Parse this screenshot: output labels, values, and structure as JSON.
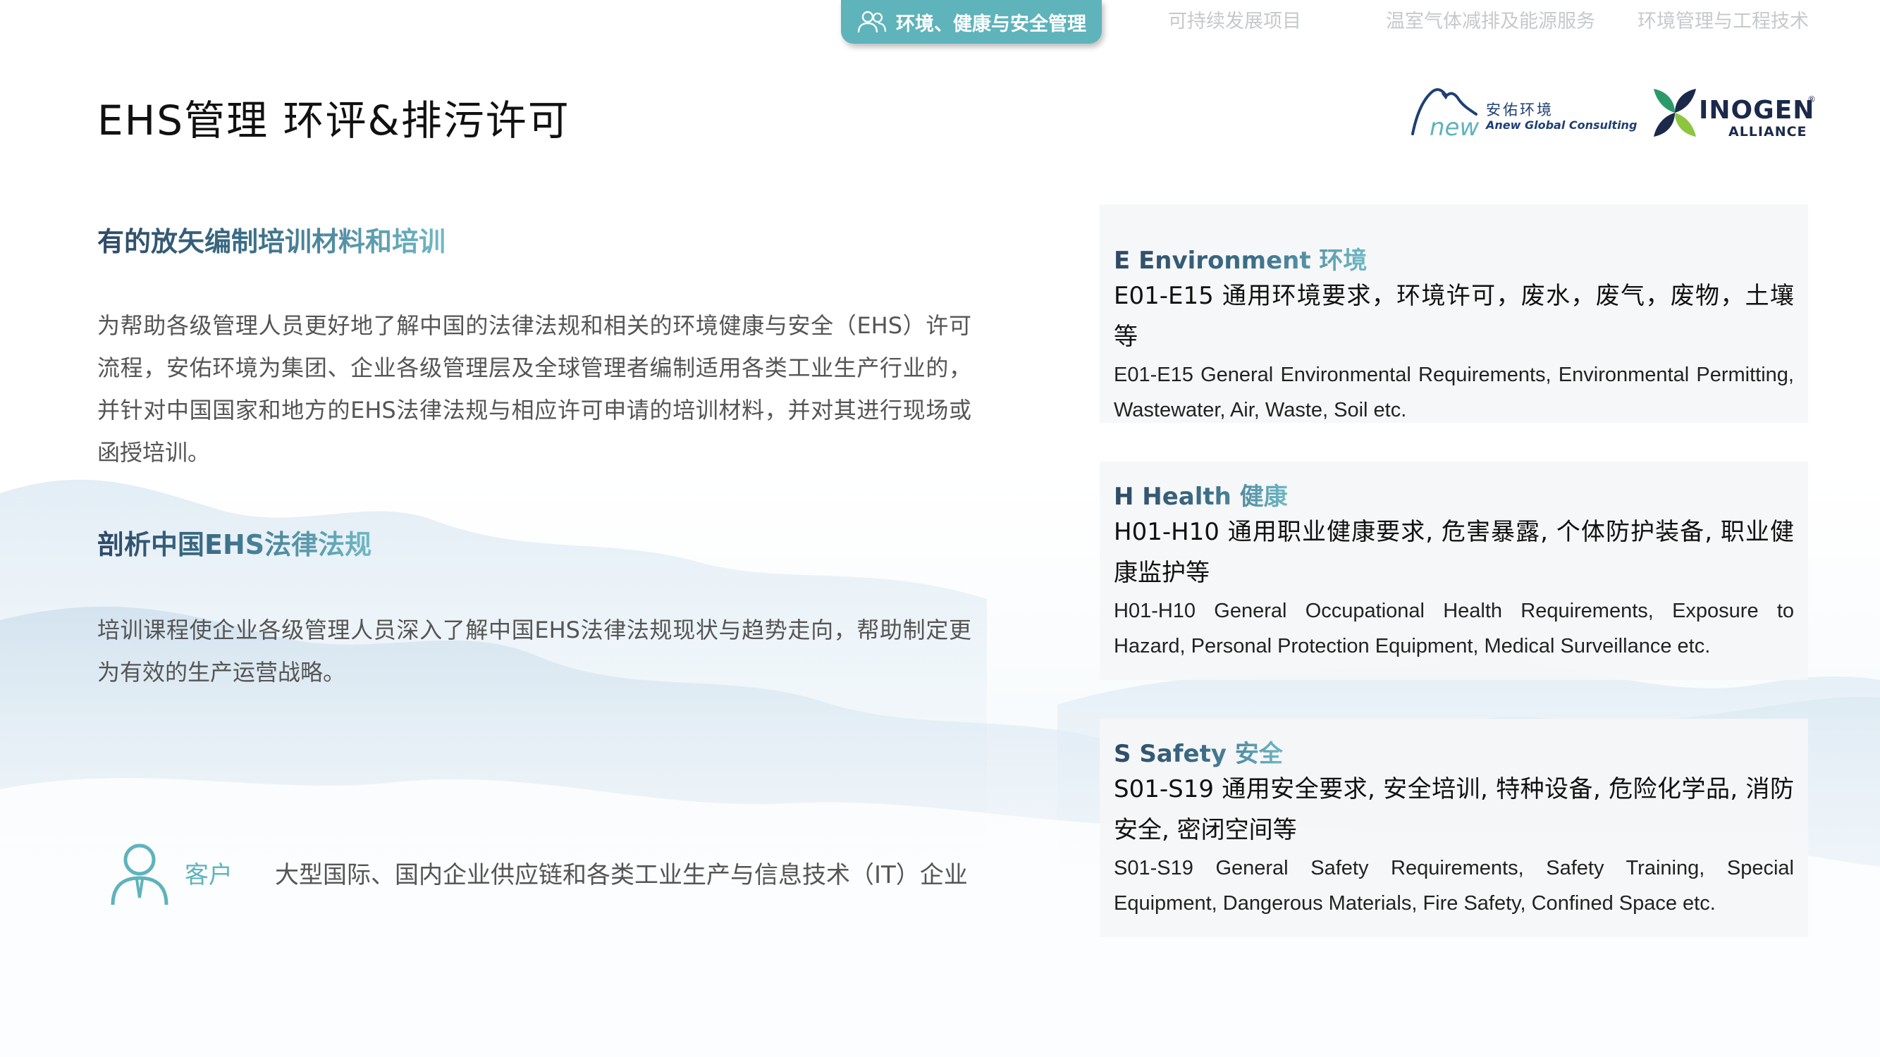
{
  "nav": {
    "active": "环境、健康与安全管理",
    "items": [
      "可持续发展项目",
      "温室气体减排及能源服务",
      "环境管理与工程技术"
    ]
  },
  "title": "EHS管理  环评&排污许可",
  "logos": {
    "anew_cn": "安佑环境",
    "anew_en": "Anew Global Consulting",
    "anew_mark": "new",
    "inogen_name": "INOGEN",
    "inogen_sub": "ALLIANCE",
    "inogen_reg": "®"
  },
  "sections": [
    {
      "heading": "有的放矢编制培训材料和培训",
      "body": "为帮助各级管理人员更好地了解中国的法律法规和相关的环境健康与安全（EHS）许可流程，安佑环境为集团、企业各级管理层及全球管理者编制适用各类工业生产行业的，并针对中国国家和地方的EHS法律法规与相应许可申请的培训材料，并对其进行现场或函授培训。"
    },
    {
      "heading": "剖析中国EHS法律法规",
      "body": "培训课程使企业各级管理人员深入了解中国EHS法律法规现状与趋势走向，帮助制定更为有效的生产运营战略。"
    }
  ],
  "client": {
    "label": "客户",
    "text": "大型国际、国内企业供应链和各类工业生产与信息技术（IT）企业"
  },
  "cards": [
    {
      "title": "E Environment 环境",
      "cn": "E01-E15 通用环境要求，环境许可，废水，废气，废物，土壤等",
      "en": "E01-E15 General Environmental Requirements, Environmental Permitting, Wastewater, Air, Waste, Soil etc."
    },
    {
      "title": "H Health 健康",
      "cn": "H01-H10 通用职业健康要求, 危害暴露, 个体防护装备, 职业健康监护等",
      "en": "H01-H10 General Occupational Health Requirements, Exposure to Hazard, Personal Protection Equipment, Medical Surveillance etc."
    },
    {
      "title": "S Safety 安全",
      "cn": "S01-S19 通用安全要求, 安全培训, 特种设备, 危险化学品, 消防安全, 密闭空间等",
      "en": "S01-S19 General Safety Requirements, Safety Training, Special Equipment, Dangerous Materials, Fire Safety, Confined Space etc."
    }
  ],
  "colors": {
    "accent": "#5fb3bb",
    "heading_dark": "#2e4966",
    "body_text": "#555555",
    "card_bg": "#f5f6f7"
  },
  "icons": {
    "nav_active": "people-icon",
    "client": "person-icon",
    "anew_logo": "mountain-logo-icon",
    "inogen_logo": "leaf-x-logo-icon"
  }
}
